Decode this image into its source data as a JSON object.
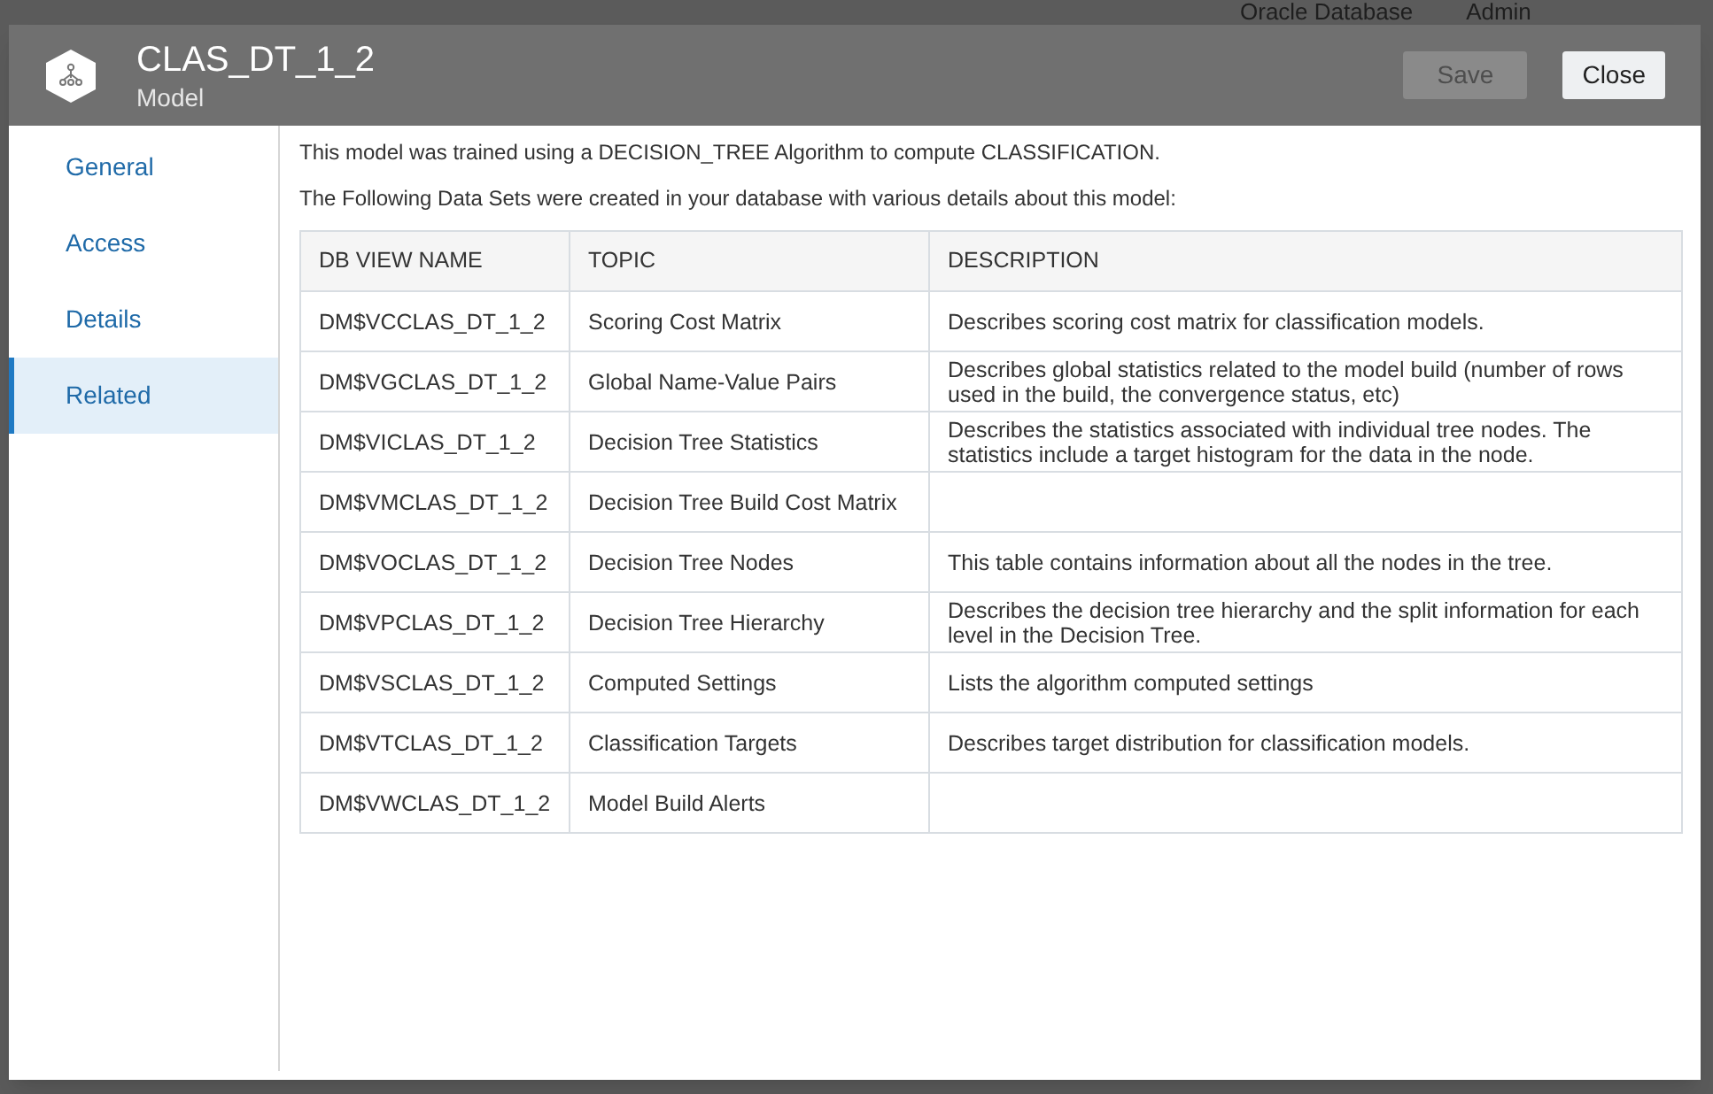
{
  "background_header": {
    "items": [
      "Oracle Database",
      "Admin"
    ]
  },
  "dialog": {
    "title": "CLAS_DT_1_2",
    "subtitle": "Model",
    "buttons": [
      {
        "label": "Save",
        "disabled": true
      },
      {
        "label": "Close",
        "disabled": false
      }
    ]
  },
  "sidebar": {
    "items": [
      {
        "label": "General",
        "selected": false
      },
      {
        "label": "Access",
        "selected": false
      },
      {
        "label": "Details",
        "selected": false
      },
      {
        "label": "Related",
        "selected": true
      }
    ]
  },
  "intro": [
    "This model was trained using a DECISION_TREE Algorithm to compute CLASSIFICATION.",
    "The Following Data Sets were created in your database with various details about this model:"
  ],
  "table": {
    "columns": [
      "DB VIEW NAME",
      "TOPIC",
      "DESCRIPTION"
    ],
    "rows": [
      [
        "DM$VCCLAS_DT_1_2",
        "Scoring Cost Matrix",
        "Describes scoring cost matrix for classification models."
      ],
      [
        "DM$VGCLAS_DT_1_2",
        "Global Name-Value Pairs",
        "Describes global statistics related to the model build (number of rows used in the build, the convergence status, etc)"
      ],
      [
        "DM$VICLAS_DT_1_2",
        "Decision Tree Statistics",
        "Describes the statistics associated with individual tree nodes. The statistics include a target histogram for the data in the node."
      ],
      [
        "DM$VMCLAS_DT_1_2",
        "Decision Tree Build Cost Matrix",
        ""
      ],
      [
        "DM$VOCLAS_DT_1_2",
        "Decision Tree Nodes",
        "This table contains information about all the nodes in the tree."
      ],
      [
        "DM$VPCLAS_DT_1_2",
        "Decision Tree Hierarchy",
        "Describes the decision tree hierarchy and the split information for each level in the Decision Tree."
      ],
      [
        "DM$VSCLAS_DT_1_2",
        "Computed Settings",
        "Lists the algorithm computed settings"
      ],
      [
        "DM$VTCLAS_DT_1_2",
        "Classification Targets",
        "Describes target distribution for classification models."
      ],
      [
        "DM$VWCLAS_DT_1_2",
        "Model Build Alerts",
        ""
      ]
    ]
  }
}
